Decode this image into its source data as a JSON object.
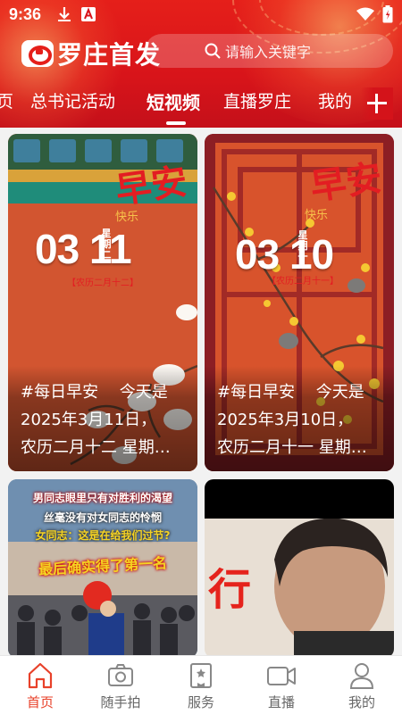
{
  "status_bar": {
    "time": "9:36"
  },
  "header": {
    "app_name": "罗庄首发",
    "search_placeholder": "请输入关键字"
  },
  "tabs": [
    {
      "label": "页"
    },
    {
      "label": "总书记活动"
    },
    {
      "label": "短视频",
      "active": true
    },
    {
      "label": "直播罗庄"
    },
    {
      "label": "我的"
    }
  ],
  "cards": [
    {
      "greeting": "早安",
      "greeting_sub": "快乐",
      "day_big": "03 11",
      "weekday": "星期二",
      "lunar": "【农历二月十二】",
      "caption_lines": [
        "#每日早安　 今天是",
        "2025年3月11日，",
        "农历二月十二  星期…"
      ]
    },
    {
      "greeting": "早安",
      "greeting_sub": "快乐",
      "day_big": "03 10",
      "weekday": "星期一",
      "lunar": "【农历二月十一】",
      "caption_lines": [
        "#每日早安　 今天是",
        "2025年3月10日，",
        "农历二月十一  星期…"
      ]
    },
    {
      "banner_lines": [
        "男同志眼里只有对胜利的渴望",
        "丝毫没有对女同志的怜悯",
        "女同志：这是在给我们过节?",
        "最后确实得了第一名"
      ]
    },
    {
      "overlay_text": "行"
    }
  ],
  "bottom_nav": [
    {
      "label": "首页",
      "icon": "home-icon",
      "active": true
    },
    {
      "label": "随手拍",
      "icon": "camera-icon"
    },
    {
      "label": "服务",
      "icon": "bookmark-icon"
    },
    {
      "label": "直播",
      "icon": "video-icon"
    },
    {
      "label": "我的",
      "icon": "user-icon"
    }
  ],
  "colors": {
    "header_red": "#d8141a",
    "active_nav": "#e8412a",
    "inactive_nav": "#888888"
  }
}
